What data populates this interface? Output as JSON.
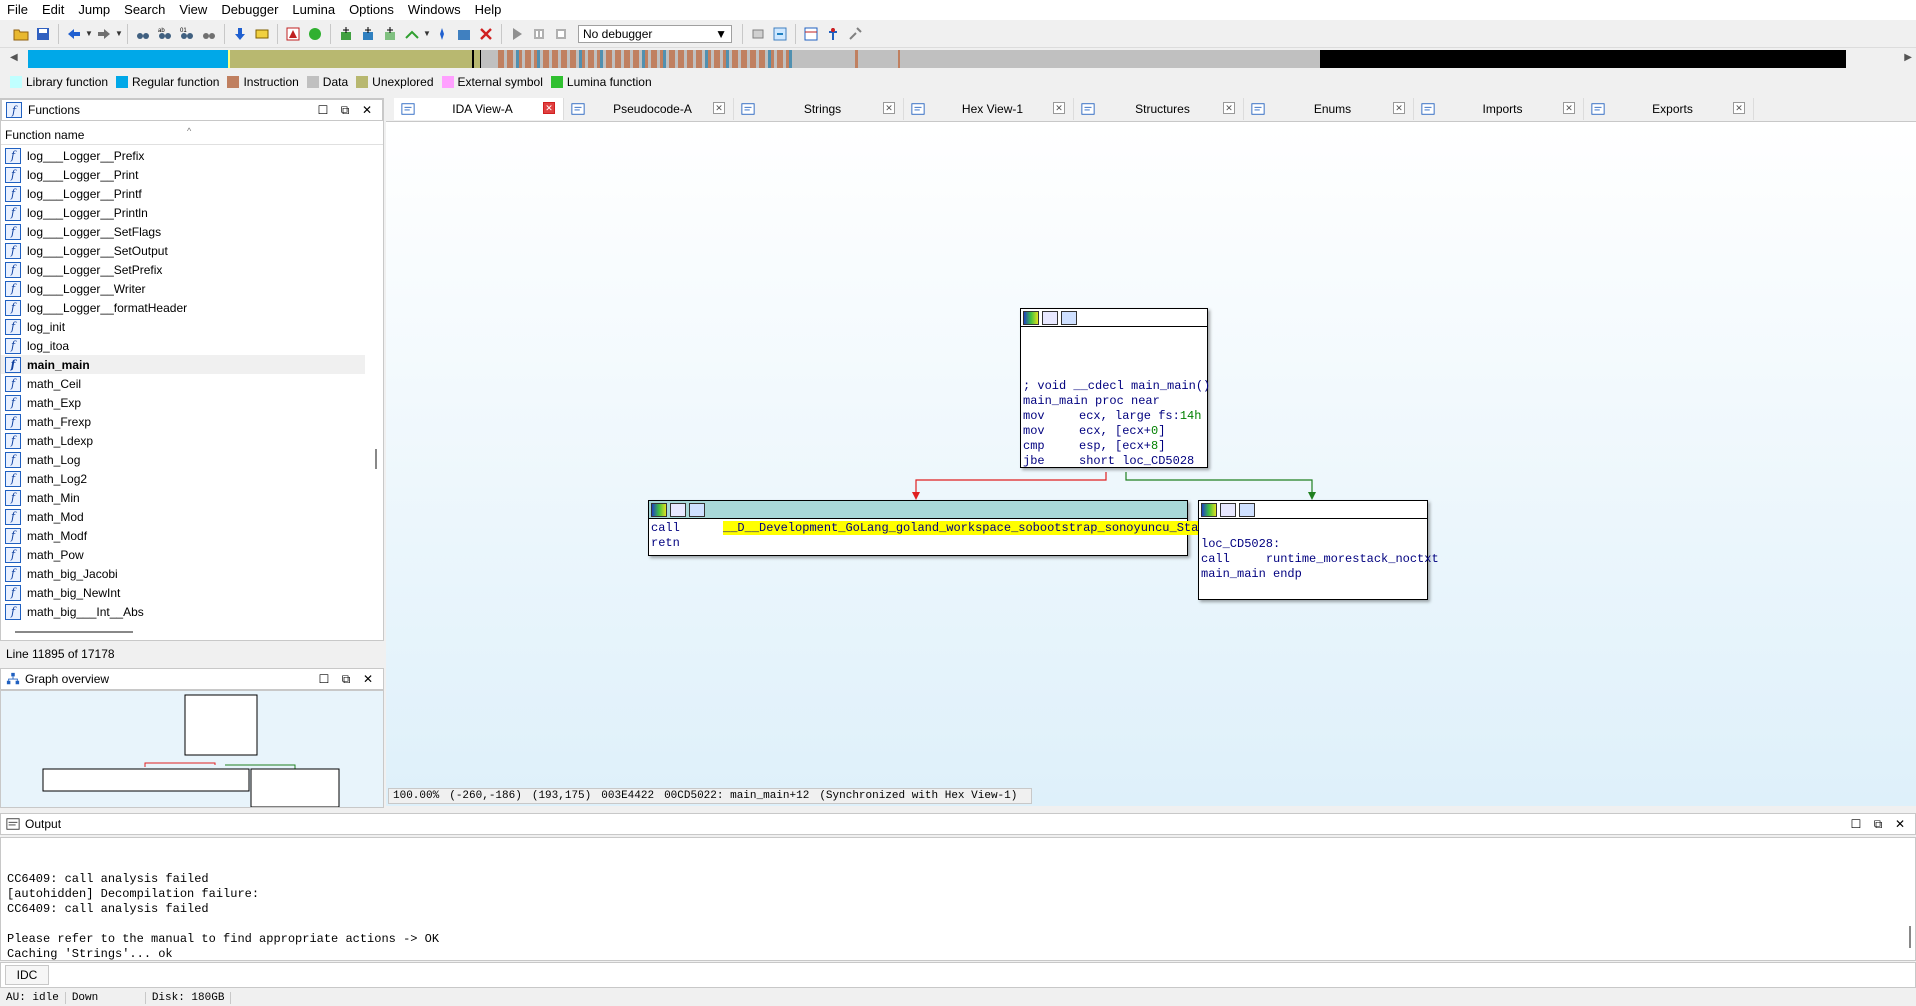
{
  "menu": [
    "File",
    "Edit",
    "Jump",
    "Search",
    "View",
    "Debugger",
    "Lumina",
    "Options",
    "Windows",
    "Help"
  ],
  "toolbar": {
    "debugger_select": "No debugger"
  },
  "legend": [
    {
      "label": "Library function",
      "color": "#c0ffff"
    },
    {
      "label": "Regular function",
      "color": "#00a8e8"
    },
    {
      "label": "Instruction",
      "color": "#c08060"
    },
    {
      "label": "Data",
      "color": "#c0c0c0"
    },
    {
      "label": "Unexplored",
      "color": "#b8b870"
    },
    {
      "label": "External symbol",
      "color": "#ffa0ff"
    },
    {
      "label": "Lumina function",
      "color": "#30c030"
    }
  ],
  "functions_panel": {
    "title": "Functions",
    "column_header": "Function name",
    "items": [
      "log___Logger__Prefix",
      "log___Logger__Print",
      "log___Logger__Printf",
      "log___Logger__Println",
      "log___Logger__SetFlags",
      "log___Logger__SetOutput",
      "log___Logger__SetPrefix",
      "log___Logger__Writer",
      "log___Logger__formatHeader",
      "log_init",
      "log_itoa",
      "main_main",
      "math_Ceil",
      "math_Exp",
      "math_Frexp",
      "math_Ldexp",
      "math_Log",
      "math_Log2",
      "math_Min",
      "math_Mod",
      "math_Modf",
      "math_Pow",
      "math_big_Jacobi",
      "math_big_NewInt",
      "math_big___Int__Abs"
    ],
    "selected_index": 11,
    "status": "Line 11895 of 17178"
  },
  "overview_panel": {
    "title": "Graph overview"
  },
  "tabs": [
    {
      "label": "IDA View-A",
      "active": true
    },
    {
      "label": "Pseudocode-A",
      "active": false
    },
    {
      "label": "Strings",
      "active": false
    },
    {
      "label": "Hex View-1",
      "active": false
    },
    {
      "label": "Structures",
      "active": false
    },
    {
      "label": "Enums",
      "active": false
    },
    {
      "label": "Imports",
      "active": false
    },
    {
      "label": "Exports",
      "active": false
    }
  ],
  "graph": {
    "node1": {
      "comment": "; void __cdecl main_main()",
      "proc": "main_main proc near",
      "lines": [
        {
          "op": "mov",
          "args": "ecx, large fs:",
          "num": "14h"
        },
        {
          "op": "mov",
          "args": "ecx, [ecx+",
          "num": "0",
          "tail": "]"
        },
        {
          "op": "cmp",
          "args": "esp, [ecx+",
          "num": "8",
          "tail": "]"
        },
        {
          "op": "jbe",
          "args": "short loc_CD5028",
          "num": "",
          "tail": ""
        }
      ]
    },
    "node2": {
      "call_op": "call",
      "call_target": "__D__Development_GoLang_goland_workspace_sobootstrap_sonoyuncu_Start",
      "retn": "retn"
    },
    "node3": {
      "label": "loc_CD5028:",
      "call_op": "call",
      "call_target": "runtime_morestack_noctxt",
      "endp": "main_main endp"
    },
    "status": {
      "zoom": "100.00%",
      "coords1": "(-260,-186)",
      "coords2": "(193,175)",
      "offset": "003E4422",
      "address": "00CD5022: main_main+12",
      "sync": "(Synchronized with Hex View-1)"
    }
  },
  "output_panel": {
    "title": "Output",
    "lines": [
      "CC6409: call analysis failed",
      "[autohidden] Decompilation failure:",
      "CC6409: call analysis failed",
      "",
      "Please refer to the manual to find appropriate actions -> OK",
      "Caching 'Strings'... ok",
      "Caching 'Strings'... ok",
      "Caching 'Strings'... ok"
    ],
    "idc_button": "IDC"
  },
  "statusbar": {
    "au": "AU:  idle",
    "direction": "Down",
    "disk": "Disk: 180GB"
  },
  "colors": {
    "graph_bg_top": "#ffffff",
    "graph_bg_bottom": "#def0fa",
    "edge_false": "#e02020",
    "edge_true": "#208020",
    "highlight": "#ffff00"
  }
}
